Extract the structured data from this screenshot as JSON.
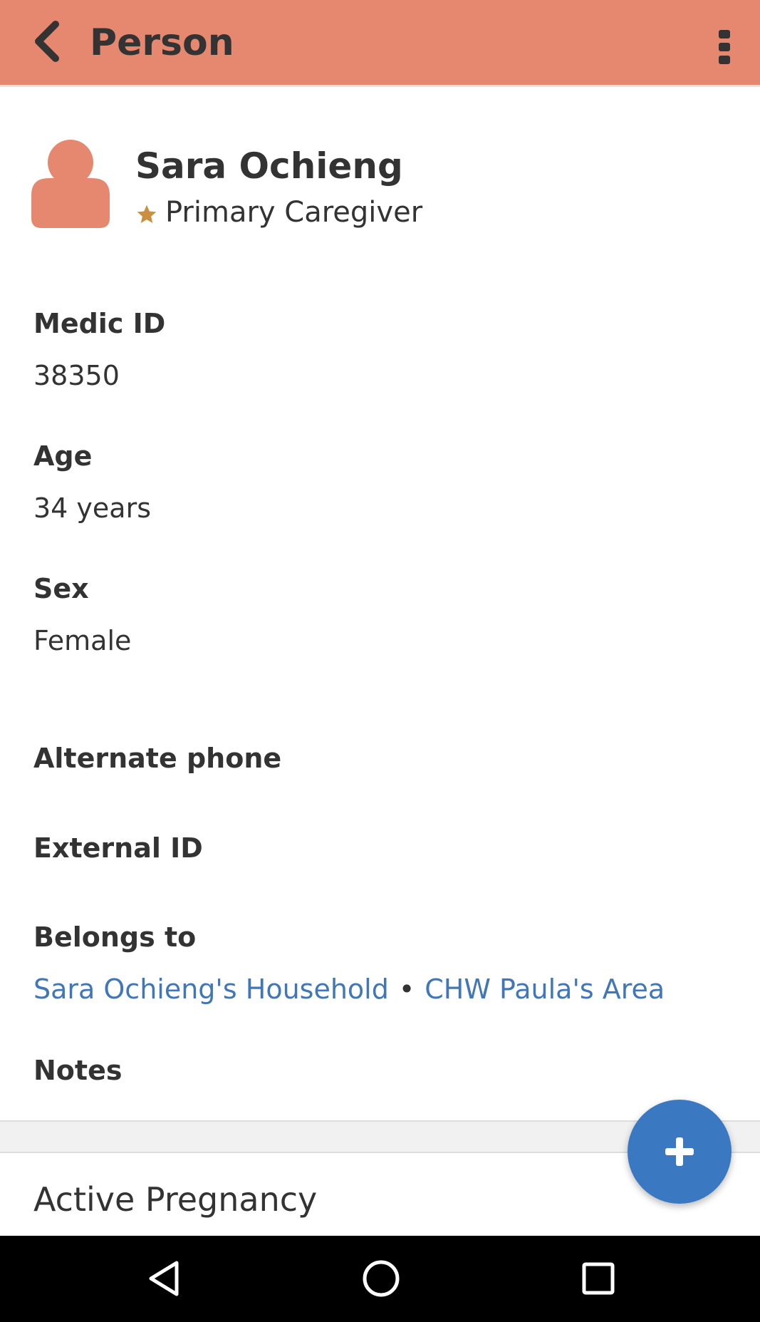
{
  "app_bar": {
    "title": "Person",
    "back_icon": "chevron-left-icon",
    "menu_icon": "more-vertical-icon",
    "background": "#e68870"
  },
  "profile": {
    "name": "Sara Ochieng",
    "role": "Primary Caregiver",
    "avatar_icon": "person-icon",
    "role_icon": "star-icon",
    "avatar_color": "#e68870",
    "star_color": "#c99043"
  },
  "fields": {
    "medic_id": {
      "label": "Medic ID",
      "value": "38350"
    },
    "age": {
      "label": "Age",
      "value": "34 years"
    },
    "sex": {
      "label": "Sex",
      "value": "Female"
    },
    "alternate_phone": {
      "label": "Alternate phone"
    },
    "external_id": {
      "label": "External ID"
    },
    "belongs_to": {
      "label": "Belongs to",
      "links": [
        "Sara Ochieng's Household",
        "CHW Paula's Area"
      ],
      "separator": "•"
    },
    "notes": {
      "label": "Notes"
    }
  },
  "section": {
    "title": "Active Pregnancy"
  },
  "fab": {
    "icon": "plus-icon",
    "color": "#3a79c2"
  },
  "system_nav": {
    "back_icon": "nav-back-icon",
    "home_icon": "nav-home-icon",
    "recents_icon": "nav-recents-icon"
  },
  "colors": {
    "link": "#3f77b8",
    "text": "#333333"
  }
}
